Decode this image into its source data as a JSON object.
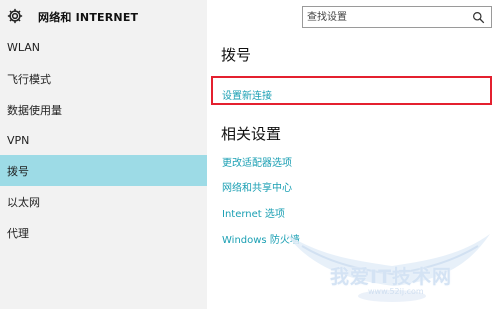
{
  "header": {
    "title": "网络和 INTERNET",
    "icon": "gear-icon"
  },
  "search": {
    "placeholder": "查找设置",
    "icon": "search-icon"
  },
  "sidebar": {
    "items": [
      {
        "label": "WLAN",
        "selected": false
      },
      {
        "label": "飞行模式",
        "selected": false
      },
      {
        "label": "数据使用量",
        "selected": false
      },
      {
        "label": "VPN",
        "selected": false
      },
      {
        "label": "拨号",
        "selected": true
      },
      {
        "label": "以太网",
        "selected": false
      },
      {
        "label": "代理",
        "selected": false
      }
    ]
  },
  "main": {
    "title": "拨号",
    "setup_link": "设置新连接",
    "related_title": "相关设置",
    "related_links": [
      "更改适配器选项",
      "网络和共享中心",
      "Internet 选项",
      "Windows 防火墙"
    ]
  },
  "watermark": {
    "text": "我爱IT技术网",
    "url": "www.52ij.com"
  },
  "colors": {
    "accent": "#1a9fb3",
    "selected_bg": "#9ddbe6",
    "sidebar_bg": "#f2f2f2",
    "highlight_border": "#e4202f"
  }
}
